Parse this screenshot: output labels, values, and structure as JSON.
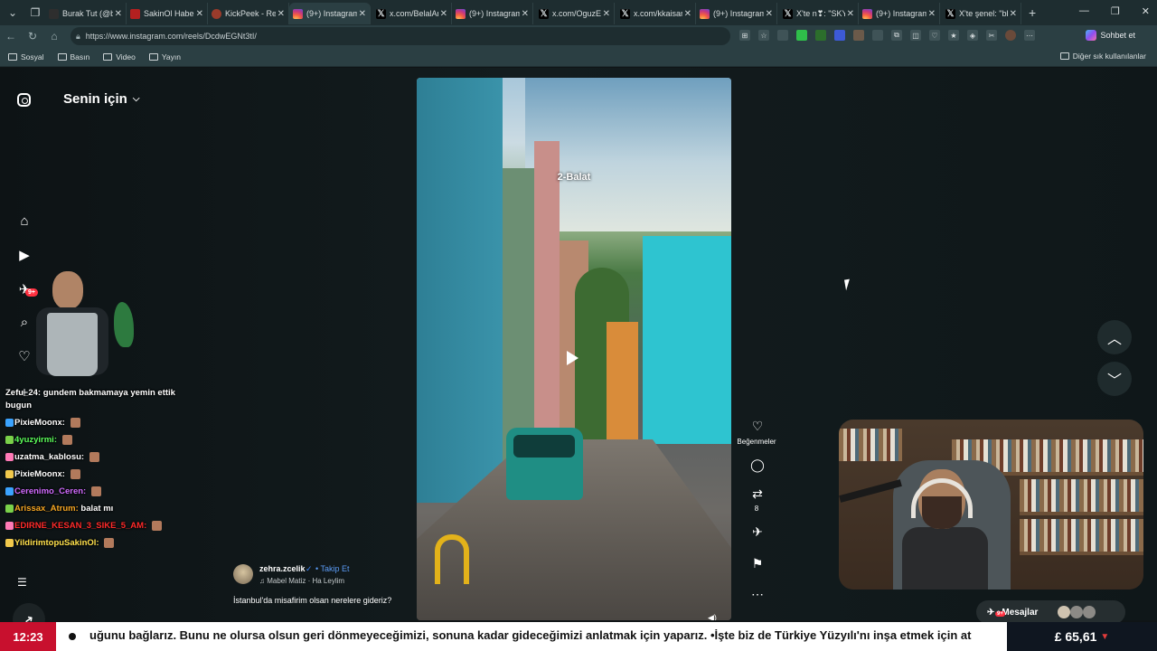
{
  "browser": {
    "tabs": [
      {
        "label": "Burak Tut (@b",
        "icon": "bt",
        "active": false
      },
      {
        "label": "SakinOl Haber",
        "icon": "so",
        "active": false
      },
      {
        "label": "KickPeek - Rea",
        "icon": "kp",
        "active": false
      },
      {
        "label": "(9+) Instagram",
        "icon": "ig",
        "active": true
      },
      {
        "label": "x.com/BelalAr",
        "icon": "x",
        "active": false
      },
      {
        "label": "(9+) Instagram",
        "icon": "ig",
        "active": false
      },
      {
        "label": "x.com/OguzEu",
        "icon": "x",
        "active": false
      },
      {
        "label": "x.com/kkaisan",
        "icon": "x",
        "active": false
      },
      {
        "label": "(9+) Instagram",
        "icon": "ig",
        "active": false
      },
      {
        "label": "X'te n❣: \"SKY",
        "icon": "x",
        "active": false
      },
      {
        "label": "(9+) Instagram",
        "icon": "ig",
        "active": false
      },
      {
        "label": "X'te şenel: \"bb",
        "icon": "x",
        "active": false
      }
    ],
    "url": "https://www.instagram.com/reels/DcdwEGNt3tI/",
    "sohbet_label": "Sohbet et",
    "bookmarks": [
      "Sosyal",
      "Basın",
      "Video",
      "Yayın"
    ],
    "bookmarks_right": "Diğer sık kullanılanlar"
  },
  "instagram": {
    "feed_title": "Senin için",
    "nav_badge": "9+",
    "video_caption": "2-Balat",
    "actions": {
      "like_label": "Beğenmeler",
      "repost_count": "8"
    },
    "author": {
      "username": "zehra.zcelik",
      "follow": "Takip Et",
      "music": "Mabel Matiz · Ha Leylim",
      "description": "İstanbul'da misafirim olsan nerelere gideriz?"
    },
    "messages_label": "Mesajlar",
    "messages_badge": "9+"
  },
  "chat": [
    {
      "user": "Zefu_24:",
      "text": "gundem bakmamaya yemin ettik bugun",
      "color": "#ffffff"
    },
    {
      "user": "PixieMoonx:",
      "text": "",
      "color": "#ffffff"
    },
    {
      "user": "4yuzyirmi:",
      "text": "",
      "color": "#5cff5c"
    },
    {
      "user": "uzatma_kablosu:",
      "text": "",
      "color": "#ffffff"
    },
    {
      "user": "PixieMoonx:",
      "text": "",
      "color": "#ffffff"
    },
    {
      "user": "Cerenimo_Ceren:",
      "text": "",
      "color": "#d16bff"
    },
    {
      "user": "Arissax_Atrum:",
      "text": "balat mı",
      "color": "#f5a623"
    },
    {
      "user": "EDIRNE_KESAN_3_SIKE_5_AM:",
      "text": "",
      "color": "#ff2a2a"
    },
    {
      "user": "YildirimtopuSakinOl:",
      "text": "",
      "color": "#ffe14d"
    }
  ],
  "ticker": {
    "time": "12:23",
    "text": "uğunu bağlarız. Bunu ne olursa olsun geri dönmeyeceğimizi, sonuna kadar gideceğimizi anlatmak için yaparız. •İşte biz de Türkiye Yüzyılı'nı inşa etmek için at",
    "price": "£ 65,61",
    "price_direction": "▼"
  }
}
